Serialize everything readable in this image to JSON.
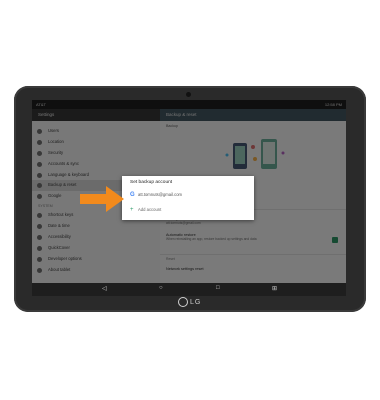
{
  "status_bar": {
    "carrier": "AT&T",
    "time": "12:58 PM"
  },
  "settings": {
    "title": "Settings",
    "items": [
      {
        "label": "Users",
        "icon": "user-icon"
      },
      {
        "label": "Location",
        "icon": "location-icon"
      },
      {
        "label": "Security",
        "icon": "lock-icon"
      },
      {
        "label": "Accounts & sync",
        "icon": "sync-icon"
      },
      {
        "label": "Language & keyboard",
        "icon": "keyboard-icon"
      },
      {
        "label": "Backup & reset",
        "icon": "backup-icon",
        "selected": true
      },
      {
        "label": "Google",
        "icon": "google-icon"
      }
    ],
    "section_label": "SYSTEM",
    "system_items": [
      {
        "label": "Shortcut keys",
        "icon": "shortcut-icon"
      },
      {
        "label": "Date & time",
        "icon": "clock-icon"
      },
      {
        "label": "Accessibility",
        "icon": "accessibility-icon"
      },
      {
        "label": "QuickCover",
        "icon": "cover-icon"
      },
      {
        "label": "Developer options",
        "icon": "developer-icon"
      },
      {
        "label": "About tablet",
        "icon": "info-icon"
      }
    ]
  },
  "detail": {
    "title": "Backup & reset",
    "subtitle": "Backup",
    "backup_account_label": "Backup account",
    "backup_account_value": "att.tomnuts@gmail.com",
    "auto_restore_label": "Automatic restore",
    "auto_restore_desc": "When reinstalling an app, restore backed up settings and data",
    "reset_section": "Reset",
    "network_reset": "Network settings reset"
  },
  "dialog": {
    "title": "Set backup account",
    "account_email": "att.tomnuts@gmail.com",
    "add_account_label": "Add account"
  },
  "nav": {
    "back": "◁",
    "home": "○",
    "recents": "□",
    "extra": "⊞"
  },
  "brand": {
    "logo_text": "LG"
  },
  "colors": {
    "arrow": "#f28a1c",
    "toggle": "#2e9c6a",
    "header_right": "#455a64"
  }
}
